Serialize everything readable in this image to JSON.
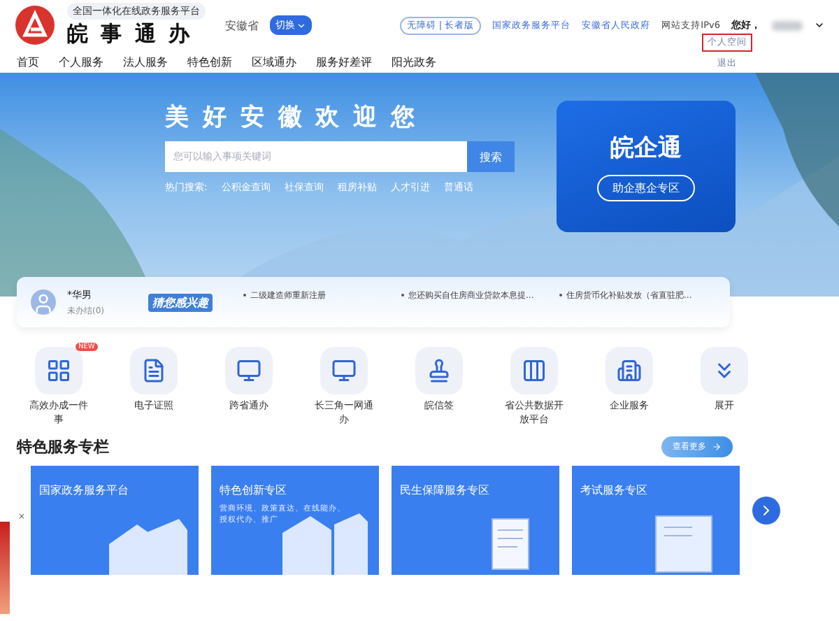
{
  "header": {
    "tagline": "全国一体化在线政务服务平台",
    "title": "皖 事 通 办",
    "region": "安徽省",
    "switch_button": "切换",
    "links": [
      {
        "label": "无障碍 | 长者版",
        "kind": "pill"
      },
      {
        "label": "国家政务服务平台",
        "kind": "link"
      },
      {
        "label": "安徽省人民政府",
        "kind": "link"
      },
      {
        "label": "网站支持IPv6",
        "kind": "plain"
      }
    ],
    "greeting": "您好，",
    "user_menu": [
      {
        "label": "个人空间",
        "highlighted": true
      },
      {
        "label": "退出",
        "highlighted": false
      }
    ]
  },
  "nav": [
    {
      "label": "首页"
    },
    {
      "label": "个人服务"
    },
    {
      "label": "法人服务"
    },
    {
      "label": "特色创新"
    },
    {
      "label": "区域通办"
    },
    {
      "label": "服务好差评"
    },
    {
      "label": "阳光政务"
    }
  ],
  "hero": {
    "slogan": "美 好 安 徽 欢 迎 您",
    "search": {
      "placeholder": "您可以输入事项关键词",
      "button": "搜索"
    },
    "hot_label": "热门搜索:",
    "hot_terms": [
      "公积金查询",
      "社保查询",
      "租房补贴",
      "人才引进",
      "普通话"
    ],
    "promo": {
      "title": "皖企通",
      "button": "助企惠企专区"
    }
  },
  "user_card": {
    "name": "*华男",
    "status": "未办结(0)",
    "interest_title": "猜您感兴趣",
    "suggestions": [
      "二级建造师重新注册",
      "您还购买自住房商业贷款本息提...",
      "住房货币化补贴发放（省直驻肥..."
    ]
  },
  "services": [
    {
      "label": "高效办成一件事",
      "badge": "NEW"
    },
    {
      "label": "电子证照"
    },
    {
      "label": "跨省通办"
    },
    {
      "label": "长三角一网通办"
    },
    {
      "label": "皖信签"
    },
    {
      "label": "省公共数据开放平台"
    },
    {
      "label": "企业服务"
    },
    {
      "label": "展开"
    }
  ],
  "featured": {
    "title": "特色服务专栏",
    "more_button": "查看更多",
    "cards": [
      {
        "title": "国家政务服务平台"
      },
      {
        "title": "特色创新专区",
        "description": "营商环境、政策直达、在线能办、授权代办、推广"
      },
      {
        "title": "民生保障服务专区"
      },
      {
        "title": "考试服务专区"
      }
    ]
  },
  "side_ad": {
    "close": "×"
  }
}
